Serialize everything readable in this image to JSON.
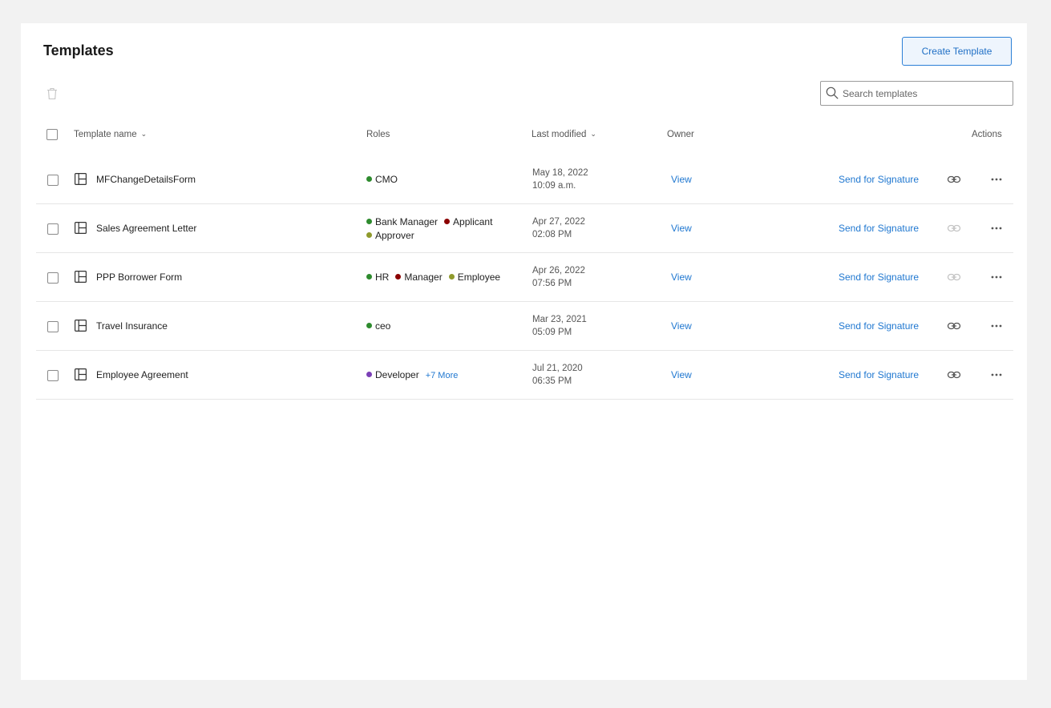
{
  "page": {
    "title": "Templates"
  },
  "toolbar": {
    "create_label": "Create Template"
  },
  "search": {
    "placeholder": "Search templates"
  },
  "table": {
    "columns": {
      "name": "Template name",
      "roles": "Roles",
      "modified": "Last modified",
      "owner": "Owner",
      "actions": "Actions"
    },
    "rows": [
      {
        "name": "MFChangeDetailsForm",
        "roles": [
          {
            "label": "CMO",
            "color": "#2e8b2e"
          }
        ],
        "date": "May 18, 2022",
        "time": "10:09 a.m.",
        "owner_link": "View",
        "action_label": "Send for Signature",
        "link_enabled": true
      },
      {
        "name": "Sales Agreement Letter",
        "roles": [
          {
            "label": "Bank Manager",
            "color": "#2e8b2e"
          },
          {
            "label": "Applicant",
            "color": "#8b0000"
          },
          {
            "label": "Approver",
            "color": "#8f9a2c"
          }
        ],
        "date": "Apr 27, 2022",
        "time": "02:08 PM",
        "owner_link": "View",
        "action_label": "Send for Signature",
        "link_enabled": false
      },
      {
        "name": "PPP Borrower Form",
        "roles": [
          {
            "label": "HR",
            "color": "#2e8b2e"
          },
          {
            "label": "Manager",
            "color": "#8b0000"
          },
          {
            "label": "Employee",
            "color": "#8f9a2c"
          }
        ],
        "date": "Apr 26, 2022",
        "time": "07:56 PM",
        "owner_link": "View",
        "action_label": "Send for Signature",
        "link_enabled": false
      },
      {
        "name": "Travel Insurance",
        "roles": [
          {
            "label": "ceo",
            "color": "#2e8b2e"
          }
        ],
        "date": "Mar 23, 2021",
        "time": "05:09 PM",
        "owner_link": "View",
        "action_label": "Send for Signature",
        "link_enabled": true
      },
      {
        "name": "Employee Agreement",
        "roles": [
          {
            "label": "Developer",
            "color": "#7b3fb6"
          }
        ],
        "more_roles": "+7 More",
        "date": "Jul 21, 2020",
        "time": "06:35 PM",
        "owner_link": "View",
        "action_label": "Send for Signature",
        "link_enabled": true
      }
    ]
  },
  "colors": {
    "accent": "#1f77d0",
    "background": "#f2f2f2",
    "icon_active": "#555555",
    "icon_disabled": "#c4c4c4"
  },
  "icons": {
    "delete": "trash-icon",
    "search": "search-icon",
    "template": "template-layout-icon",
    "copy_link": "link-icon",
    "more": "more-horizontal-icon",
    "sort": "chevron-down-icon"
  }
}
